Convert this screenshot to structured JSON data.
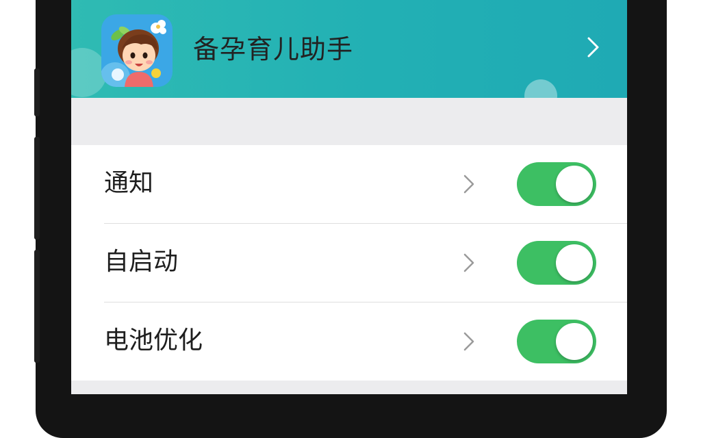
{
  "header": {
    "app_name": "备孕育儿助手",
    "colors": {
      "gradient_start": "#2fbbb3",
      "gradient_end": "#1faab4"
    },
    "app_icon": "cartoon-child-app-icon",
    "chevron_icon": "chevron-right-icon"
  },
  "settings": {
    "items": [
      {
        "label": "通知",
        "enabled": true
      },
      {
        "label": "自启动",
        "enabled": true
      },
      {
        "label": "电池优化",
        "enabled": true
      }
    ],
    "toggle_on_color": "#3dbf63",
    "chevron_icon": "chevron-right-icon"
  }
}
